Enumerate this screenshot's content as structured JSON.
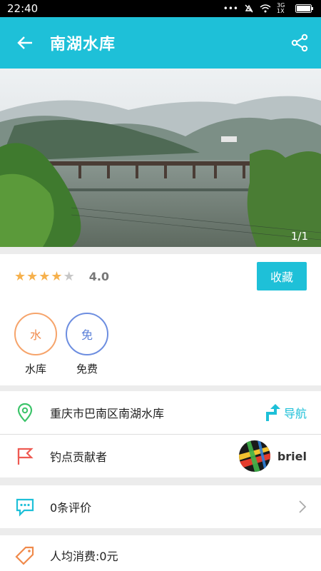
{
  "status_bar": {
    "time": "22:40",
    "network": "3G 1X"
  },
  "app_bar": {
    "title": "南湖水库"
  },
  "hero": {
    "counter": "1/1"
  },
  "rating": {
    "stars_filled": 4,
    "stars_total": 5,
    "score": "4.0",
    "favorite_label": "收藏"
  },
  "tags": [
    {
      "icon_text": "水",
      "label": "水库",
      "color": "#f08a4b"
    },
    {
      "icon_text": "免",
      "label": "免费",
      "color": "#5a7fd8"
    }
  ],
  "location": {
    "address": "重庆市巴南区南湖水库",
    "nav_label": "导航"
  },
  "contributor": {
    "label": "钓点贡献者",
    "username": "briel"
  },
  "reviews": {
    "label": "0条评价"
  },
  "spend": {
    "label": "人均消费:0元"
  },
  "colors": {
    "accent": "#1ec0d8",
    "star": "#f6b14d"
  }
}
